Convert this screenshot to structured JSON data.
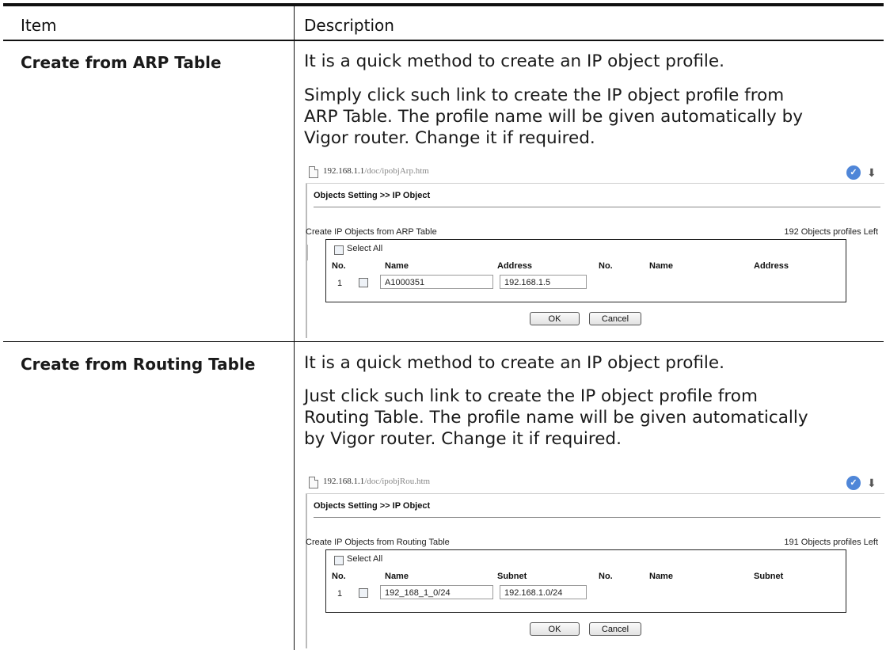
{
  "table": {
    "header": {
      "item": "Item",
      "description": "Description"
    },
    "rows": [
      {
        "item": "Create from ARP Table",
        "lines": [
          "It is a quick method to create an IP object profile.",
          "Simply click such link to create the IP object profile from",
          "ARP Table. The profile name will be given automatically by",
          "Vigor router. Change it if required."
        ],
        "screenshot": {
          "url_host": "192.168.1.1",
          "url_path": "/doc/ipobjArp.htm",
          "breadcrumb": "Objects Setting >> IP Object",
          "box_title": "Create IP Objects from ARP Table",
          "profiles_left": "192 Objects profiles Left",
          "select_all": "Select All",
          "columns": [
            "No.",
            "Name",
            "Address",
            "No.",
            "Name",
            "Address"
          ],
          "row": {
            "no": "1",
            "name": "A1000351",
            "value": "192.168.1.5"
          },
          "ok": "OK",
          "cancel": "Cancel"
        }
      },
      {
        "item": "Create from Routing Table",
        "lines": [
          "It is a quick method to create an IP object profile.",
          "Just click such link to create the IP object profile from",
          "Routing Table. The profile name will be given automatically",
          "by Vigor router. Change it if required."
        ],
        "screenshot": {
          "url_host": "192.168.1.1",
          "url_path": "/doc/ipobjRou.htm",
          "breadcrumb": "Objects Setting >> IP Object",
          "box_title": "Create IP Objects from Routing Table",
          "profiles_left": "191 Objects profiles Left",
          "select_all": "Select All",
          "columns": [
            "No.",
            "Name",
            "Subnet",
            "No.",
            "Name",
            "Subnet"
          ],
          "row": {
            "no": "1",
            "name": "192_168_1_0/24",
            "value": "192.168.1.0/24"
          },
          "ok": "OK",
          "cancel": "Cancel"
        }
      }
    ]
  },
  "icons": {
    "doc": "page-icon",
    "badge": "info-badge-icon",
    "download": "download-arrow-icon"
  },
  "colors": {
    "badge": "#4f86d8",
    "rule": "#111111"
  }
}
